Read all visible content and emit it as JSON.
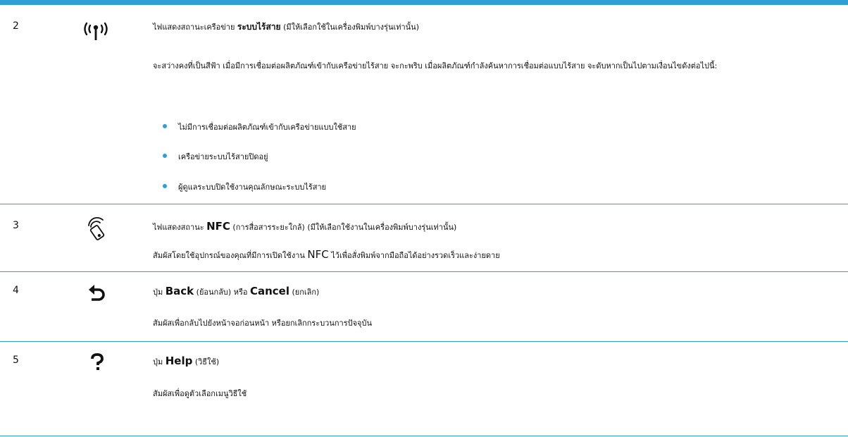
{
  "rows": [
    {
      "number": "2",
      "icon": "wireless-icon",
      "heading_pre": "ไฟแสดงสถานะเครือข่าย ",
      "heading_bold": "ระบบไร้สาย",
      "heading_post": " (มีให้เลือกใช้ในเครื่องพิมพ์บางรุ่นเท่านั้น)",
      "description": "จะสว่างคงที่เป็นสีฟ้า เมื่อมีการเชื่อมต่อผลิตภัณฑ์เข้ากับเครือข่ายไร้สาย จะกะพริบ เมื่อผลิตภัณฑ์กำลังค้นหาการเชื่อมต่อแบบไร้สาย จะดับหากเป็นไปตามเงื่อนไขดังต่อไปนี้:",
      "bullets": [
        "ไม่มีการเชื่อมต่อผลิตภัณฑ์เข้ากับเครือข่ายแบบใช้สาย",
        "เครือข่ายระบบไร้สายปิดอยู่",
        "ผู้ดูแลระบบปิดใช้งานคุณลักษณะระบบไร้สาย"
      ]
    },
    {
      "number": "3",
      "icon": "nfc-icon",
      "heading_pre": "ไฟแสดงสถานะ ",
      "heading_bold": "NFC",
      "heading_post": " (การสื่อสารระยะใกล้) (มีให้เลือกใช้งานในเครื่องพิมพ์บางรุ่นเท่านั้น)",
      "description_pre": "สัมผัสโดยใช้อุปกรณ์ของคุณที่มีการเปิดใช้งาน ",
      "description_bold": "NFC",
      "description_post": " ไว้เพื่อสั่งพิมพ์จากมือถือได้อย่างรวดเร็วและง่ายดาย"
    },
    {
      "number": "4",
      "icon": "back-arrow-icon",
      "heading_pre": "ปุ่ม ",
      "heading_bold": "Back",
      "heading_mid": " (ย้อนกลับ) หรือ ",
      "heading_bold2": "Cancel",
      "heading_post": " (ยกเลิก)",
      "description": "สัมผัสเพื่อกลับไปยังหน้าจอก่อนหน้า หรือยกเลิกกระบวนการปัจจุบัน"
    },
    {
      "number": "5",
      "icon": "help-question-icon",
      "heading_pre": "ปุ่ม ",
      "heading_bold": "Help",
      "heading_post": " (วิธีใช้)",
      "description": "สัมผัสเพื่อดูตัวเลือกเมนูวิธีใช้"
    }
  ],
  "colors": {
    "accent": "#2e9fd3",
    "text": "#111111"
  }
}
